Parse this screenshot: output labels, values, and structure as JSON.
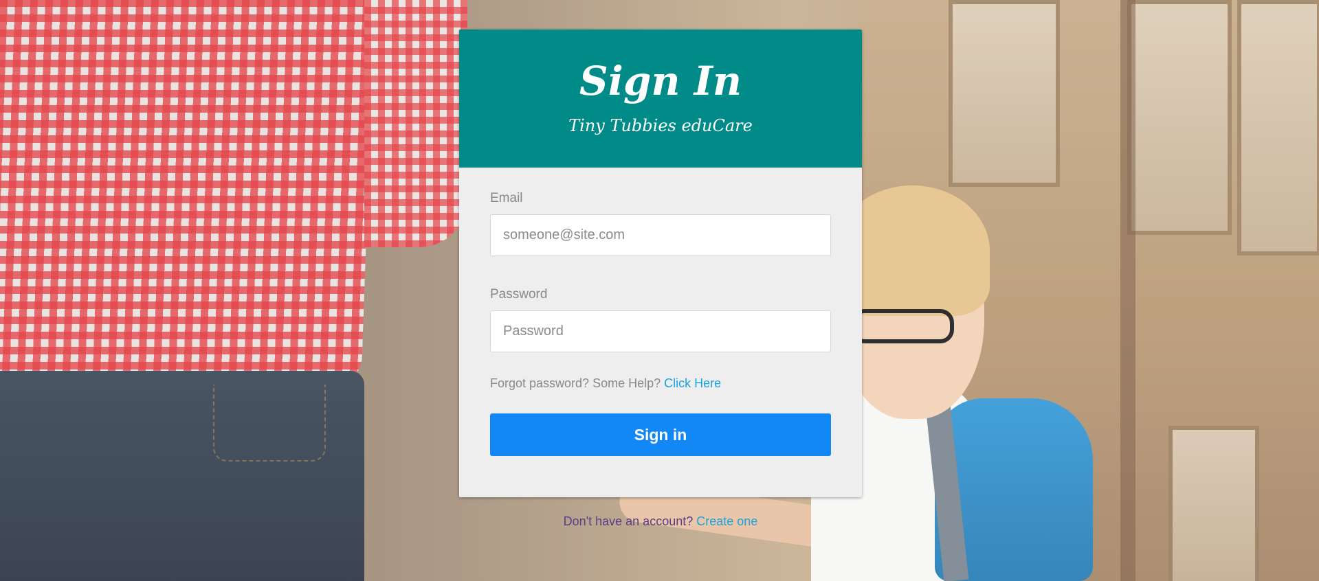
{
  "card": {
    "title": "Sign In",
    "subtitle": "Tiny Tubbies eduCare"
  },
  "form": {
    "email_label": "Email",
    "email_placeholder": "someone@site.com",
    "email_value": "",
    "password_label": "Password",
    "password_placeholder": "Password",
    "password_value": "",
    "forgot_text": "Forgot password? Some Help?",
    "forgot_link": "Click Here",
    "submit_label": "Sign in"
  },
  "footer": {
    "text": "Don't have an account?",
    "link": "Create one"
  },
  "colors": {
    "header_bg": "#008b89",
    "button_bg": "#1188f5",
    "link": "#19a3e0",
    "card_bg": "#eeeeee",
    "footer_text": "#5b3e86"
  },
  "background": {
    "icon": "photo-parent-and-child"
  }
}
